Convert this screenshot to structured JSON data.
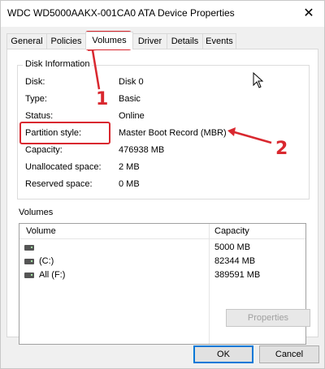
{
  "window": {
    "title": "WDC WD5000AAKX-001CA0 ATA Device Properties",
    "close_glyph": "✕"
  },
  "tabs": [
    {
      "label": "General",
      "active": false
    },
    {
      "label": "Policies",
      "active": false
    },
    {
      "label": "Volumes",
      "active": true
    },
    {
      "label": "Driver",
      "active": false
    },
    {
      "label": "Details",
      "active": false
    },
    {
      "label": "Events",
      "active": false
    }
  ],
  "disk_info": {
    "group_label": "Disk Information",
    "rows": [
      {
        "label": "Disk:",
        "value": "Disk 0"
      },
      {
        "label": "Type:",
        "value": "Basic"
      },
      {
        "label": "Status:",
        "value": "Online"
      },
      {
        "label": "Partition style:",
        "value": "Master Boot Record (MBR)"
      },
      {
        "label": "Capacity:",
        "value": "476938 MB"
      },
      {
        "label": "Unallocated space:",
        "value": "2 MB"
      },
      {
        "label": "Reserved space:",
        "value": "0 MB"
      }
    ]
  },
  "volumes": {
    "section_label": "Volumes",
    "columns": [
      "Volume",
      "Capacity"
    ],
    "rows": [
      {
        "volume": "",
        "capacity": "5000 MB",
        "icon": "drive-icon"
      },
      {
        "volume": "(C:)",
        "capacity": "82344 MB",
        "icon": "drive-icon"
      },
      {
        "volume": "All (F:)",
        "capacity": "389591 MB",
        "icon": "drive-icon"
      }
    ]
  },
  "buttons": {
    "properties": "Properties",
    "ok": "OK",
    "cancel": "Cancel"
  },
  "annotations": {
    "marker_1": "1",
    "marker_2": "2",
    "color": "#d9282f"
  }
}
